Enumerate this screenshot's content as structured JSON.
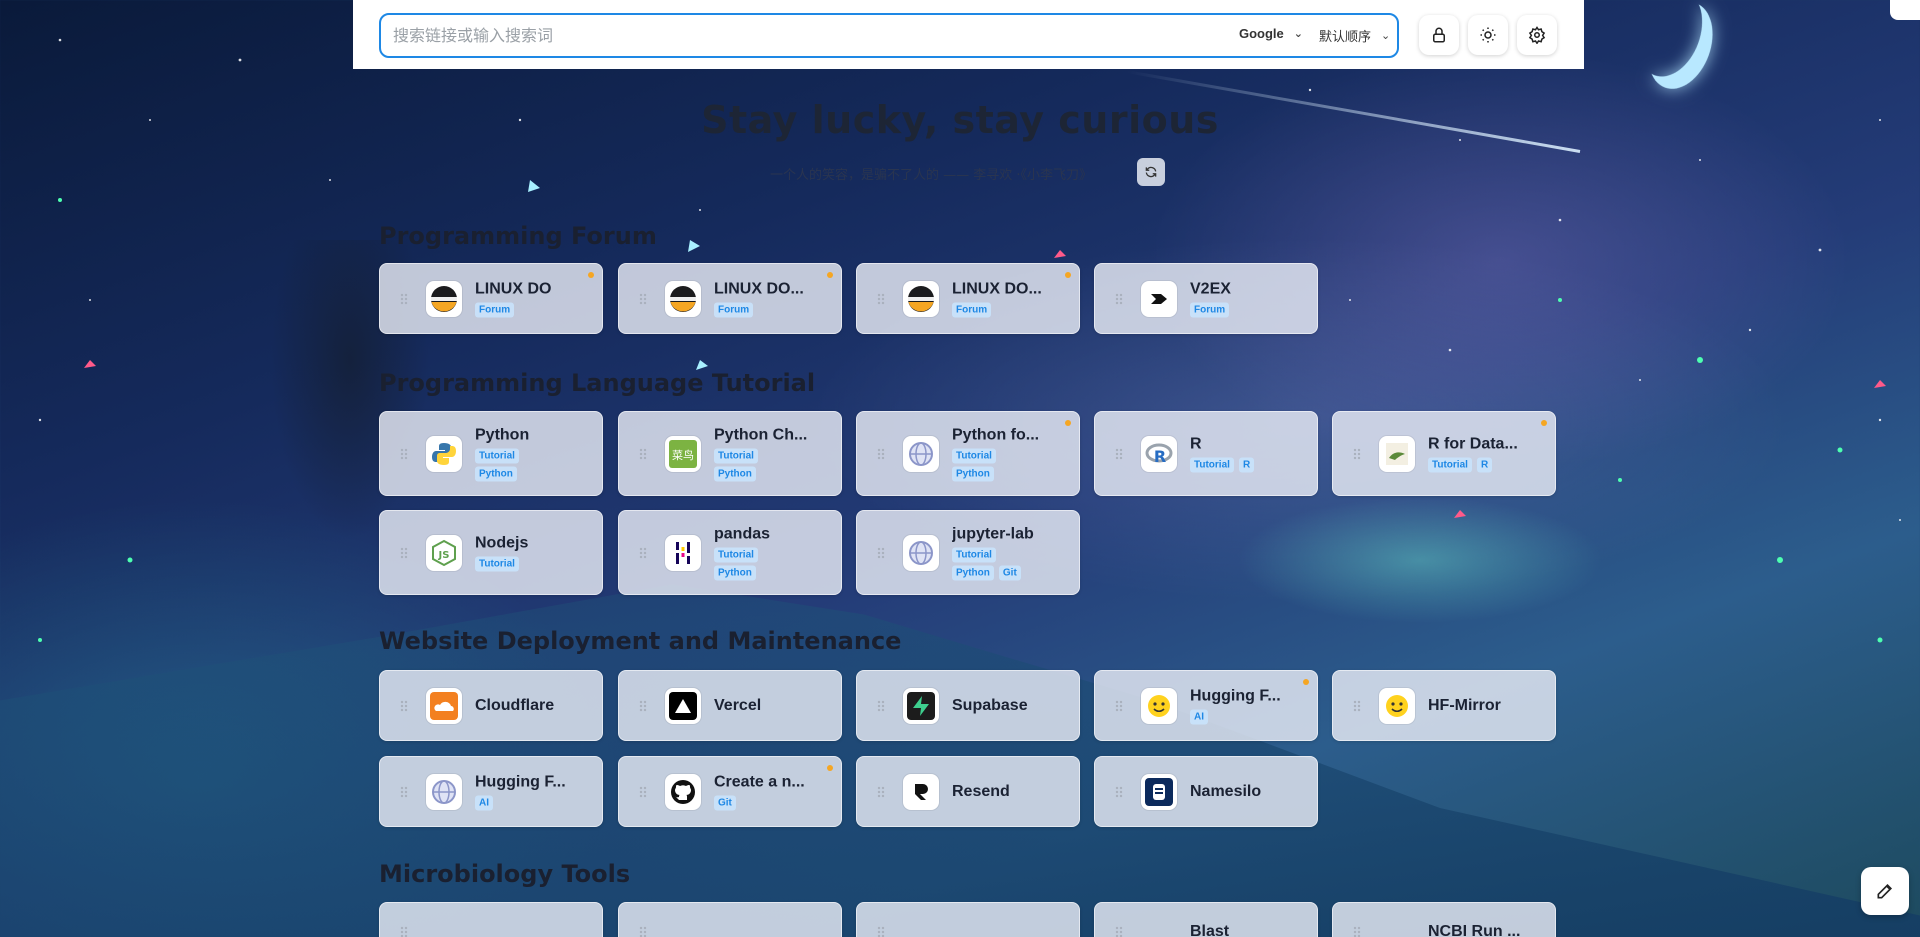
{
  "search": {
    "placeholder": "搜索链接或输入搜索词",
    "engine": "Google",
    "order": "默认顺序"
  },
  "hero": {
    "title": "Stay lucky, stay curious",
    "quote": "一个人的笑容，是骗不了人的 —— 李寻欢 ·《小李飞刀》"
  },
  "sections": [
    {
      "title": "Programming Forum",
      "cards": [
        {
          "title": "LINUX DO",
          "tags": [
            "Forum"
          ],
          "icon": "linuxdo-icon",
          "dot": true
        },
        {
          "title": "LINUX DO...",
          "tags": [
            "Forum"
          ],
          "icon": "linuxdo-icon",
          "dot": true
        },
        {
          "title": "LINUX DO...",
          "tags": [
            "Forum"
          ],
          "icon": "linuxdo-icon",
          "dot": true
        },
        {
          "title": "V2EX",
          "tags": [
            "Forum"
          ],
          "icon": "v2ex-icon",
          "dot": false
        }
      ]
    },
    {
      "title": "Programming Language Tutorial",
      "cards": [
        {
          "title": "Python",
          "tags": [
            "Tutorial",
            "Python"
          ],
          "icon": "python-icon",
          "dot": false
        },
        {
          "title": "Python Ch...",
          "tags": [
            "Tutorial",
            "Python"
          ],
          "icon": "runoob-icon",
          "dot": false
        },
        {
          "title": "Python fo...",
          "tags": [
            "Tutorial",
            "Python"
          ],
          "icon": "globe-icon",
          "dot": true
        },
        {
          "title": "R",
          "tags": [
            "Tutorial",
            "R"
          ],
          "icon": "r-icon",
          "dot": false
        },
        {
          "title": "R for Data...",
          "tags": [
            "Tutorial",
            "R"
          ],
          "icon": "book-icon",
          "dot": true
        },
        {
          "title": "Nodejs",
          "tags": [
            "Tutorial"
          ],
          "icon": "nodejs-icon",
          "dot": false
        },
        {
          "title": "pandas",
          "tags": [
            "Tutorial",
            "Python"
          ],
          "icon": "pandas-icon",
          "dot": false
        },
        {
          "title": "jupyter-lab",
          "tags": [
            "Tutorial",
            "Python",
            "Git"
          ],
          "icon": "globe-icon",
          "dot": false
        }
      ]
    },
    {
      "title": "Website Deployment and Maintenance",
      "cards": [
        {
          "title": "Cloudflare",
          "tags": [],
          "icon": "cloudflare-icon",
          "dot": false
        },
        {
          "title": "Vercel",
          "tags": [],
          "icon": "vercel-icon",
          "dot": false
        },
        {
          "title": "Supabase",
          "tags": [],
          "icon": "supabase-icon",
          "dot": false
        },
        {
          "title": "Hugging F...",
          "tags": [
            "AI"
          ],
          "icon": "huggingface-icon",
          "dot": true
        },
        {
          "title": "HF-Mirror",
          "tags": [],
          "icon": "huggingface-icon",
          "dot": false
        },
        {
          "title": "Hugging F...",
          "tags": [
            "AI"
          ],
          "icon": "globe-icon",
          "dot": false
        },
        {
          "title": "Create a n...",
          "tags": [
            "Git"
          ],
          "icon": "github-icon",
          "dot": true
        },
        {
          "title": "Resend",
          "tags": [],
          "icon": "resend-icon",
          "dot": false
        },
        {
          "title": "Namesilo",
          "tags": [],
          "icon": "namesilo-icon",
          "dot": false
        }
      ]
    },
    {
      "title": "Microbiology Tools",
      "cards": [
        {
          "title": "",
          "tags": [],
          "icon": "",
          "dot": false
        },
        {
          "title": "",
          "tags": [],
          "icon": "",
          "dot": false
        },
        {
          "title": "",
          "tags": [],
          "icon": "",
          "dot": false
        },
        {
          "title": "Blast",
          "tags": [],
          "icon": "",
          "dot": false
        },
        {
          "title": "NCBI Run ...",
          "tags": [],
          "icon": "",
          "dot": false
        }
      ]
    }
  ],
  "colors": {
    "accent": "#1e88e5",
    "dot": "#f5a623",
    "tag_bg": "#c8e1fa"
  }
}
